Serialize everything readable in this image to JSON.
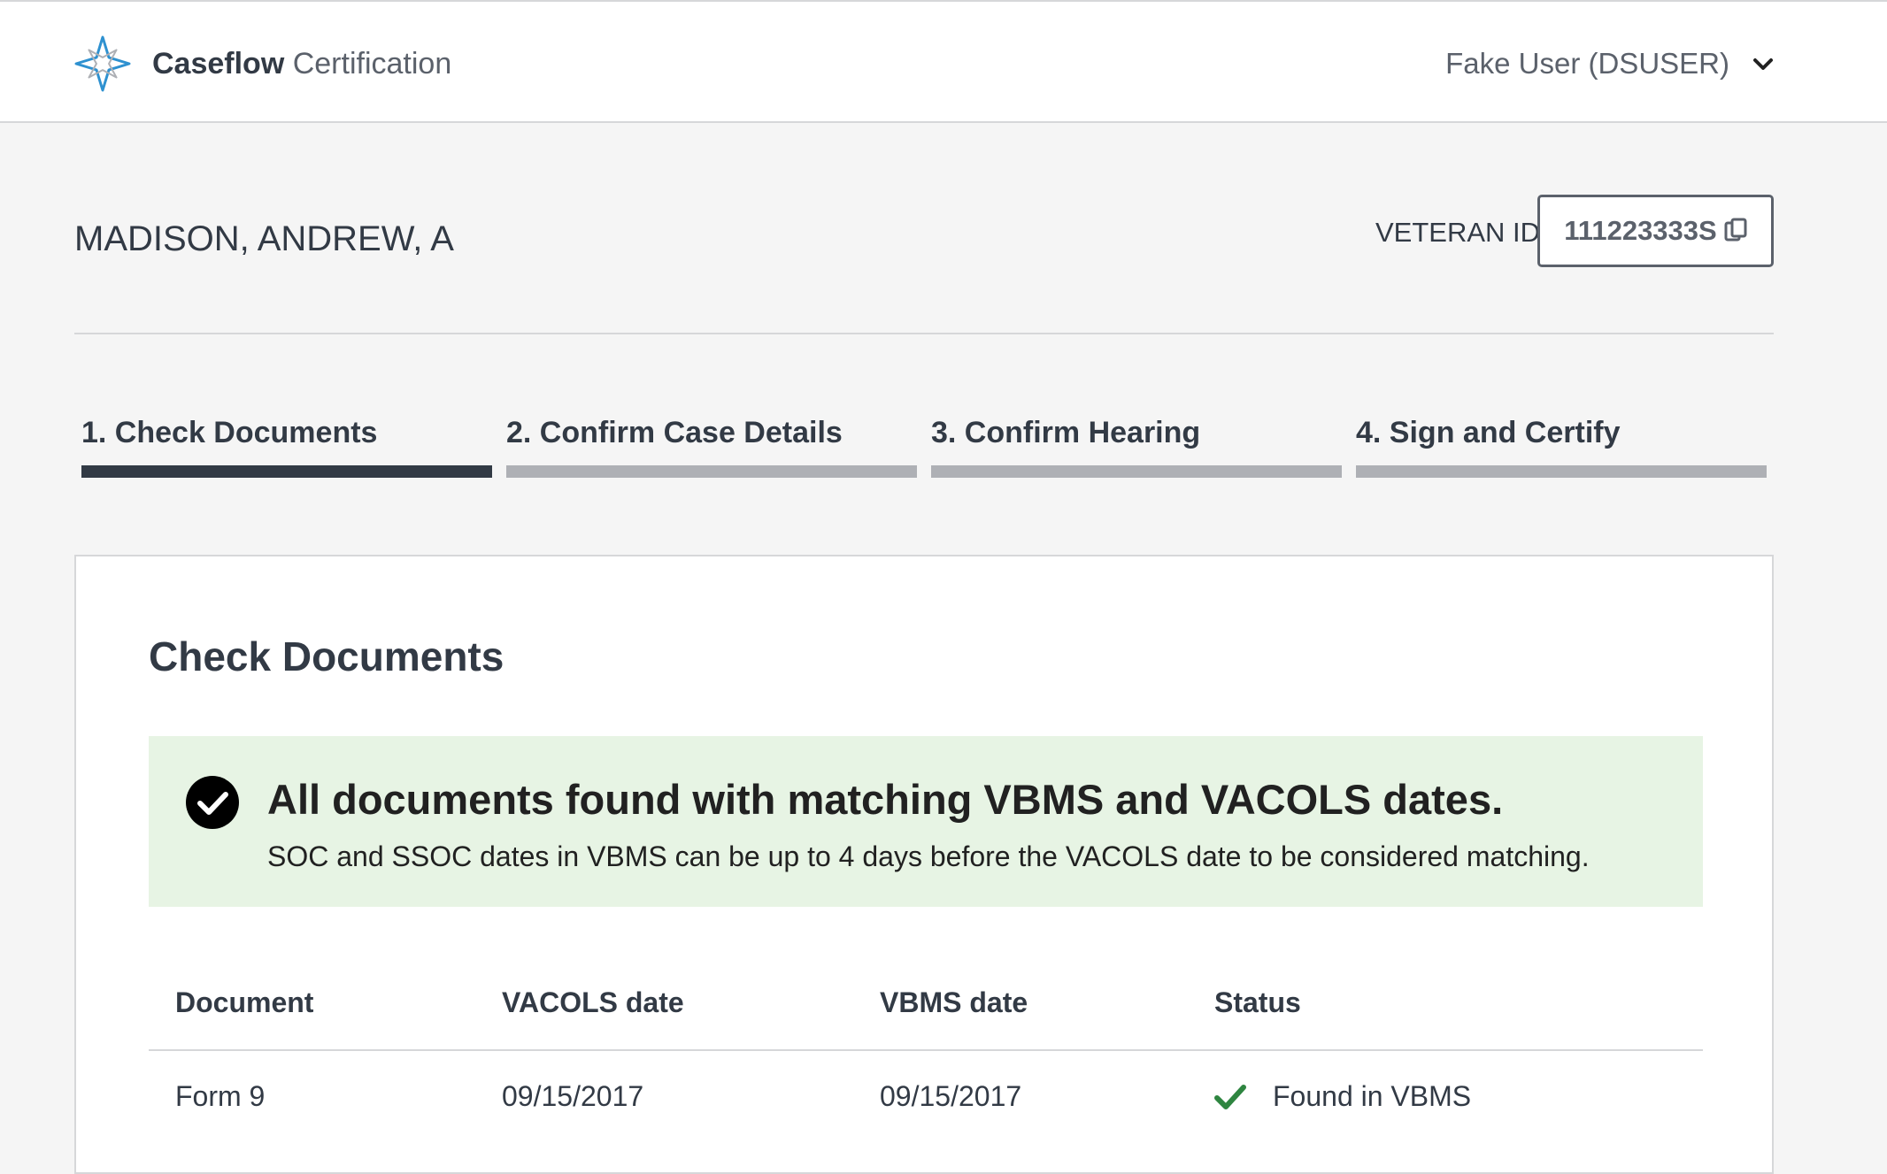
{
  "header": {
    "brand": "Caseflow",
    "app_name": "Certification",
    "user_label": "Fake User (DSUSER)",
    "logo_icon": "caseflow-logo-icon",
    "menu_icon": "chevron-down-icon"
  },
  "veteran": {
    "name": "MADISON, ANDREW, A",
    "id_label": "VETERAN ID",
    "id_value": "111223333S",
    "copy_icon": "copy-icon"
  },
  "steps": [
    {
      "label": "1. Check Documents",
      "active": true
    },
    {
      "label": "2. Confirm Case Details",
      "active": false
    },
    {
      "label": "3. Confirm Hearing",
      "active": false
    },
    {
      "label": "4. Sign and Certify",
      "active": false
    }
  ],
  "main": {
    "title": "Check Documents",
    "alert": {
      "heading": "All documents found with matching VBMS and VACOLS dates.",
      "body": "SOC and SSOC dates in VBMS can be up to 4 days before the VACOLS date to be considered matching.",
      "icon": "check-circle-icon"
    },
    "table": {
      "columns": [
        "Document",
        "VACOLS date",
        "VBMS date",
        "Status"
      ],
      "rows": [
        {
          "document": "Form 9",
          "vacols_date": "09/15/2017",
          "vbms_date": "09/15/2017",
          "status": "Found in VBMS",
          "status_icon": "checkmark-icon"
        }
      ]
    }
  },
  "colors": {
    "text": "#323a45",
    "muted": "#5b616b",
    "accent": "#0071bc",
    "success_bg": "#e7f4e4",
    "success": "#2e8540",
    "step_inactive": "#aeb0b5",
    "step_active": "#323a45"
  }
}
